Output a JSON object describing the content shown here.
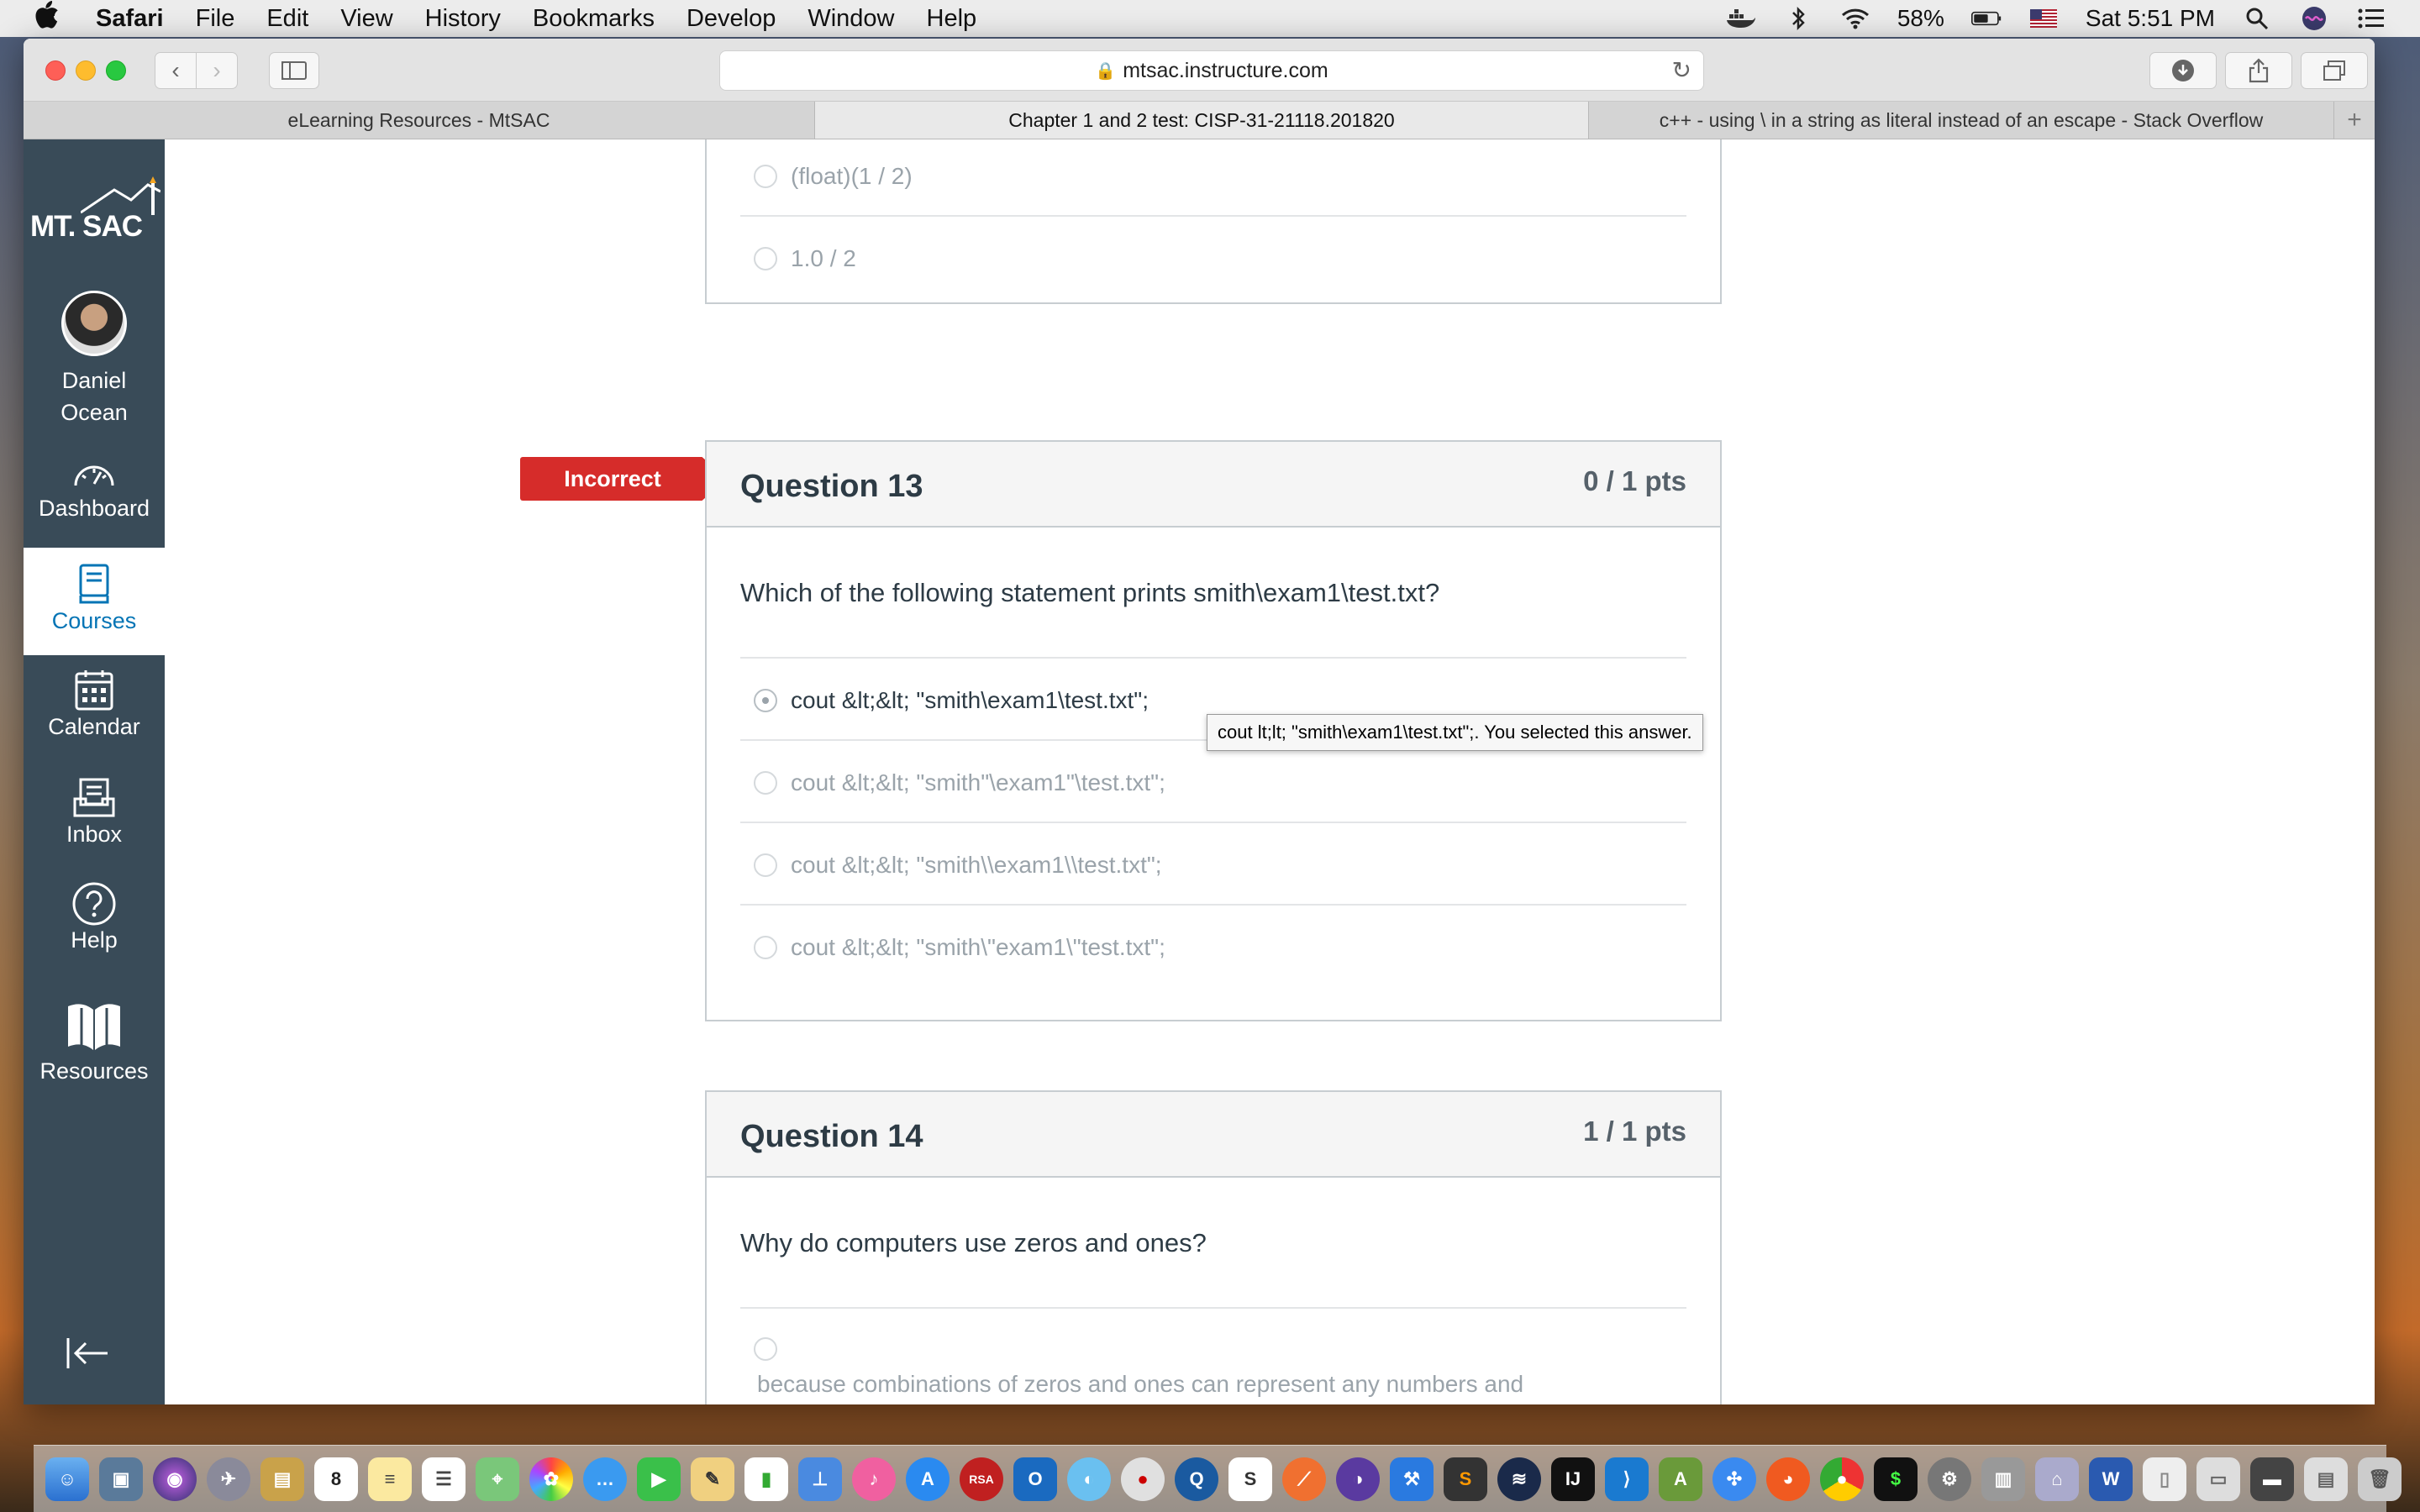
{
  "menubar": {
    "apple": "",
    "app": "Safari",
    "items": [
      "File",
      "Edit",
      "View",
      "History",
      "Bookmarks",
      "Develop",
      "Window",
      "Help"
    ],
    "battery": "58%",
    "clock": "Sat 5:51 PM"
  },
  "browser": {
    "url": "mtsac.instructure.com",
    "tabs": [
      {
        "title": "eLearning Resources - MtSAC",
        "active": false
      },
      {
        "title": "Chapter 1 and 2 test: CISP-31-21118.201820",
        "active": true
      },
      {
        "title": "c++ - using \\ in a string as literal instead of an escape - Stack Overflow",
        "active": false
      }
    ]
  },
  "nav": {
    "logo": "MT. SAC",
    "user": "Daniel Ocean",
    "items": [
      {
        "label": "Dashboard",
        "icon": "dashboard-icon"
      },
      {
        "label": "Courses",
        "icon": "courses-icon",
        "active": true
      },
      {
        "label": "Calendar",
        "icon": "calendar-icon"
      },
      {
        "label": "Inbox",
        "icon": "inbox-icon"
      },
      {
        "label": "Help",
        "icon": "help-icon"
      },
      {
        "label": "Resources",
        "icon": "resources-icon"
      }
    ]
  },
  "question12": {
    "answers": [
      "(float)(1 / 2)",
      "1.0 / 2"
    ]
  },
  "question13": {
    "badge": "Incorrect",
    "title": "Question 13",
    "points": "0 / 1 pts",
    "text": "Which of the following statement prints smith\\exam1\\test.txt?",
    "answers": [
      "cout &lt;&lt; \"smith\\exam1\\test.txt\";",
      "cout &lt;&lt; \"smith\"\\exam1\"\\test.txt\";",
      "cout &lt;&lt; \"smith\\\\exam1\\\\test.txt\";",
      "cout &lt;&lt; \"smith\\\"exam1\\\"test.txt\";"
    ],
    "selected_index": 0,
    "tooltip": "cout lt;lt; \"smith\\exam1\\test.txt\";. You selected this answer."
  },
  "question14": {
    "title": "Question 14",
    "points": "1 / 1 pts",
    "text": "Why do computers use zeros and ones?",
    "answers": [
      "because combinations of zeros and ones can represent any numbers and characters."
    ]
  }
}
